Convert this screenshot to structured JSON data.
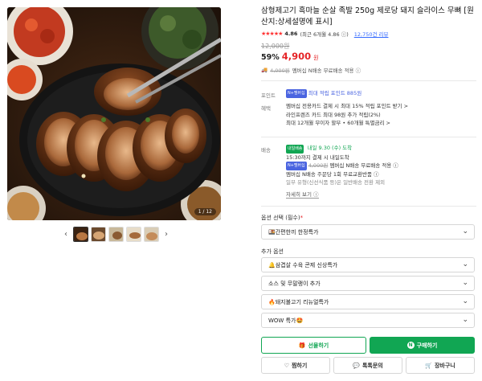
{
  "product": {
    "title": "삼형제고기 흑마늘 순살 족발 250g 제로당 돼지 슬라이스 무뼈 [원산지:상세설명에 표시]",
    "rating_stars": "★★★★★",
    "rating_score": "4.86",
    "rating_detail": "(최근 6개월 4.86 ⓘ)",
    "review_count": "12,750건 리뷰",
    "original_price": "12,000원",
    "discount": "59%",
    "price": "4,900",
    "price_unit": "원",
    "member_shipping_icon": "truck-icon",
    "member_shipping_strike": "4,000원",
    "member_shipping_text": "멤버십 N배송 무료배송 적용 ⓘ"
  },
  "gallery": {
    "page_indicator": "1 / 12",
    "prev_icon": "chevron-left-icon",
    "next_icon": "chevron-right-icon"
  },
  "benefits": {
    "point_label": "포인트",
    "point_badge": "N+멤버십",
    "point_text": "최대 적립 포인트 885원",
    "label": "혜택",
    "lines": [
      "멤버십 전용카드 결제 시 최대 15% 적립 포인트 받기 >",
      "라인프렌즈 카드 최대 98원 추가 적립(2%)",
      "최대 12개월 무이자 할부 • 60개월 특별금리 >"
    ]
  },
  "delivery": {
    "label": "배송",
    "badge": "내일배송",
    "arrival": "내일 9.30 (수) 도착",
    "cutoff": "15:30까지 결제 시 내일도착",
    "member_badge": "N+멤버십",
    "fee_strike": "4,000원",
    "fee_text": "멤버십 N배송 무료배송 적용 ⓘ",
    "exchange": "멤버십 N배송 주문당 1회 무료교환반품 ⓘ",
    "note": "일부 유형(신선식품 등)은 일반배송 전환 제외",
    "more": "자세히 보기 ⓘ"
  },
  "options": {
    "title": "옵션 선택 (필수)",
    "required_mark": "*",
    "selected": "🍱간편한끼 한정특가",
    "extra_title": "추가 옵션",
    "extras": [
      "🔔삼겹살 수육 콘제 신상특가",
      "소스 및 무말랭이 추가",
      "🔥돼지불고기 리뉴얼특가",
      "WOW 특가🤩"
    ]
  },
  "actions": {
    "gift": "선물하기",
    "buy": "구매하기",
    "buy_icon_letter": "N",
    "wish": "찜하기",
    "inquiry": "톡톡문의",
    "cart": "장바구니"
  },
  "colors": {
    "accent_green": "#11a653",
    "price_red": "#e52528",
    "point_blue": "#4a64e0"
  }
}
